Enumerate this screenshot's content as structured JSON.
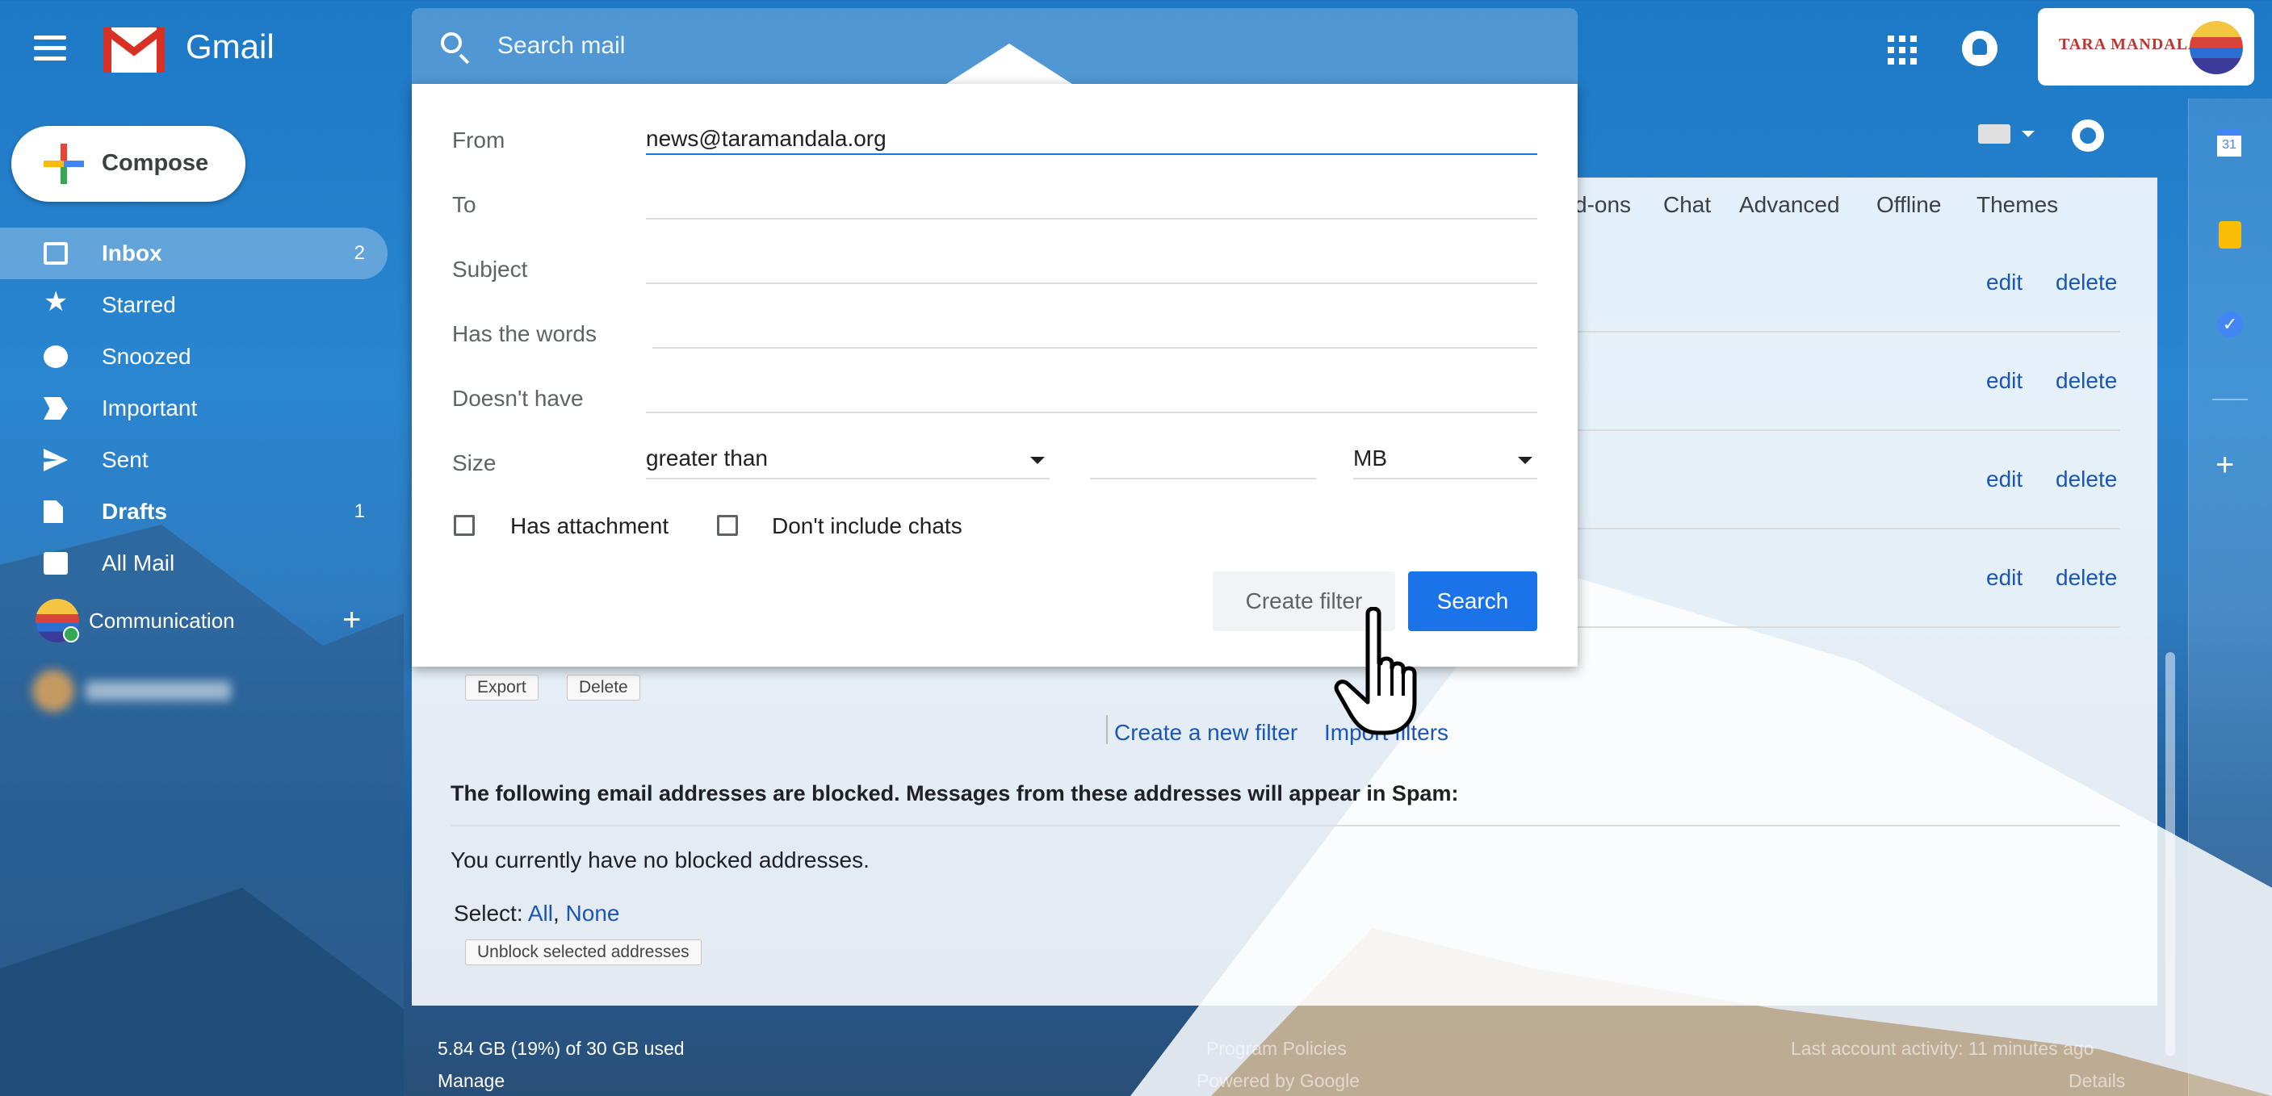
{
  "app": {
    "name": "Gmail"
  },
  "account": {
    "logo_text": "TARA MANDALA"
  },
  "search": {
    "placeholder": "Search mail"
  },
  "compose": {
    "label": "Compose"
  },
  "sidebar": {
    "items": [
      {
        "label": "Inbox",
        "count": "2",
        "icon": "inbox-icon"
      },
      {
        "label": "Starred",
        "count": "",
        "icon": "star-icon"
      },
      {
        "label": "Snoozed",
        "count": "",
        "icon": "clock-icon"
      },
      {
        "label": "Important",
        "count": "",
        "icon": "important-icon"
      },
      {
        "label": "Sent",
        "count": "",
        "icon": "send-icon"
      },
      {
        "label": "Drafts",
        "count": "1",
        "icon": "draft-icon"
      },
      {
        "label": "All Mail",
        "count": "",
        "icon": "mail-icon"
      }
    ],
    "label_section": {
      "label": "Communication",
      "add_symbol": "+"
    }
  },
  "settings_tabs": [
    "d-ons",
    "Chat",
    "Advanced",
    "Offline",
    "Themes"
  ],
  "filter_rows": [
    {
      "edit": "edit",
      "delete": "delete"
    },
    {
      "edit": "edit",
      "delete": "delete"
    },
    {
      "edit": "edit",
      "delete": "delete"
    },
    {
      "edit": "edit",
      "delete": "delete"
    }
  ],
  "filter_actions": {
    "export": "Export",
    "delete": "Delete",
    "create_new_filter": "Create a new filter",
    "import_filters": "Import filters"
  },
  "blocked": {
    "heading": "The following email addresses are blocked. Messages from these addresses will appear in Spam:",
    "empty_text": "You currently have no blocked addresses.",
    "select_label": "Select:",
    "select_all": "All",
    "select_separator": ",",
    "select_none": "None",
    "unblock_button": "Unblock selected addresses"
  },
  "footer": {
    "storage": "5.84 GB (19%) of 30 GB used",
    "manage": "Manage",
    "program_policies": "Program Policies",
    "powered_by": "Powered by Google",
    "last_activity": "Last account activity: 11 minutes ago",
    "details": "Details"
  },
  "side_panel": {
    "calendar_day": "31",
    "add_symbol": "+"
  },
  "filter_form": {
    "from_label": "From",
    "from_value": "news@taramandala.org",
    "to_label": "To",
    "subject_label": "Subject",
    "has_words_label": "Has the words",
    "doesnt_have_label": "Doesn't have",
    "size_label": "Size",
    "size_comparator": "greater than",
    "size_unit": "MB",
    "has_attachment_label": "Has attachment",
    "dont_include_chats_label": "Don't include chats",
    "create_filter_button": "Create filter",
    "search_button": "Search"
  }
}
